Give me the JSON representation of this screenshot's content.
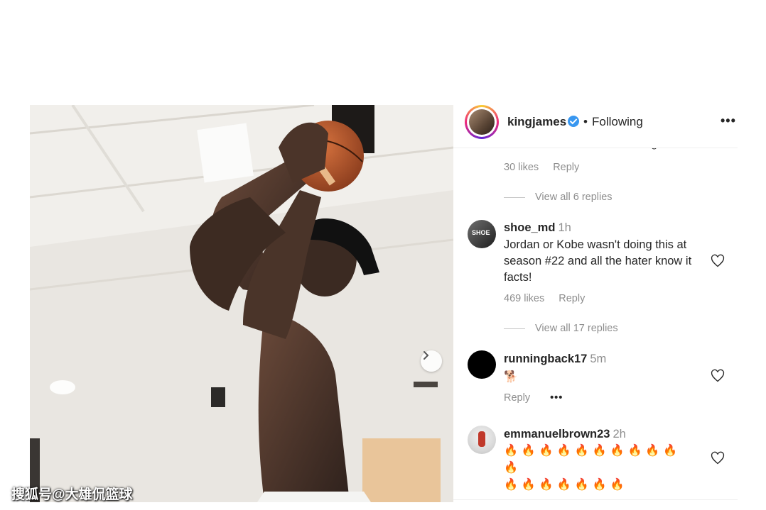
{
  "post": {
    "image_alt": "player shooting a basketball",
    "next_arrow_icon": "chevron-right-icon"
  },
  "header": {
    "username": "kingjames",
    "dot": "•",
    "follow_status": "Following",
    "more_icon": "ellipsis-icon",
    "more_label": "•••"
  },
  "comments": {
    "cut_off_text": "Derek Fisher in the cut smiling",
    "first": {
      "likes": "30 likes",
      "reply_label": "Reply",
      "view_replies": "View all 6 replies"
    },
    "items": [
      {
        "username": "shoe_md",
        "time": "1h",
        "text": "Jordan or Kobe wasn't doing this at season #22 and all the hater know it facts!",
        "likes": "469 likes",
        "reply_label": "Reply",
        "view_replies": "View all 17 replies"
      },
      {
        "username": "runningback17",
        "time": "5m",
        "text": "🐕",
        "reply_label": "Reply",
        "more_label": "•••"
      },
      {
        "username": "emmanuelbrown23",
        "time": "2h",
        "text_line1": "🔥🔥🔥🔥🔥🔥🔥🔥🔥🔥🔥",
        "text_line2": "🔥🔥🔥🔥🔥🔥🔥"
      }
    ]
  },
  "watermark": "搜狐号@大雄侃篮球",
  "colors": {
    "text": "#262626",
    "secondary": "#8e8e8e",
    "verified": "#3897f0",
    "fire": "#f58220"
  }
}
